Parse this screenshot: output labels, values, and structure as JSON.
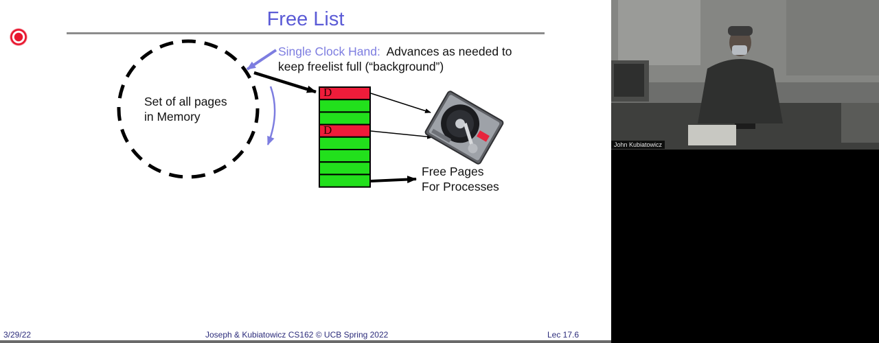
{
  "slide": {
    "title": "Free List",
    "circle_label_line1": "Set of all pages",
    "circle_label_line2": "in Memory",
    "hand_label": "Single Clock Hand:",
    "hand_desc_line1": "Advances as needed to",
    "hand_desc_line2": "keep freelist full (“background”)",
    "dirty_marker": "D",
    "free_pages_line1": "Free Pages",
    "free_pages_line2": "For Processes",
    "frame_colors": [
      "red",
      "green",
      "green",
      "red",
      "green",
      "green",
      "green",
      "green"
    ]
  },
  "footer": {
    "date": "3/29/22",
    "course": "Joseph & Kubiatowicz CS162 © UCB Spring 2022",
    "lecture": "Lec 17.6"
  },
  "video": {
    "speaker_name": "John Kubiatowicz"
  },
  "colors": {
    "title": "#5b5bd6",
    "dirty": "#ee1c3a",
    "clean": "#22e01c",
    "recording": "#e8162e"
  },
  "icons": {
    "recording": "record-icon",
    "disk": "hard-disk-icon"
  }
}
